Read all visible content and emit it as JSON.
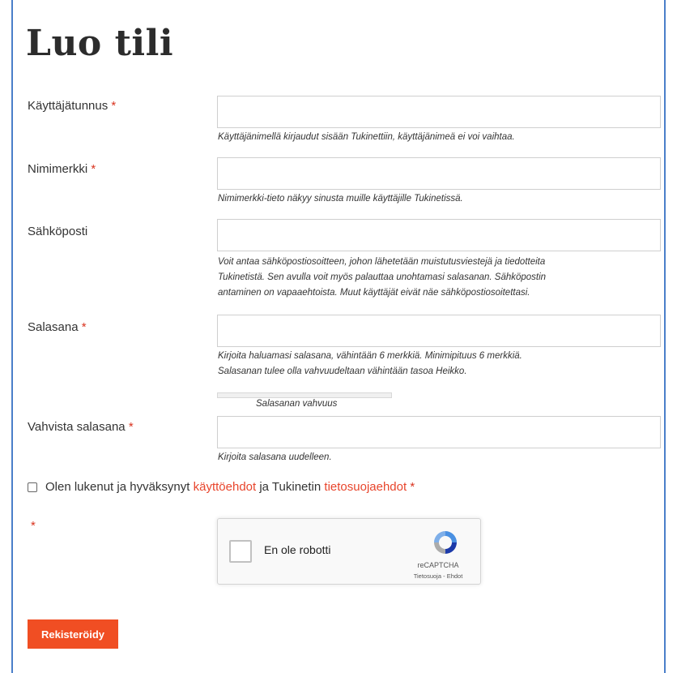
{
  "page": {
    "title": "Luo tili"
  },
  "fields": {
    "username": {
      "label": "Käyttäjätunnus",
      "required_mark": "*",
      "value": "",
      "help": "Käyttäjänimellä kirjaudut sisään Tukinettiin, käyttäjänimeä ei voi vaihtaa."
    },
    "nickname": {
      "label": "Nimimerkki",
      "required_mark": "*",
      "value": "",
      "help": "Nimimerkki-tieto näkyy sinusta muille käyttäjille Tukinetissä."
    },
    "email": {
      "label": "Sähköposti",
      "value": "",
      "help_lines": [
        "Voit antaa sähköpostiosoitteen, johon lähetetään muistutusviestejä ja tiedotteita",
        "Tukinetistä. Sen avulla voit myös palauttaa unohtamasi salasanan. Sähköpostin",
        "antaminen on vapaaehtoista. Muut käyttäjät eivät näe sähköpostiosoitettasi."
      ]
    },
    "password": {
      "label": "Salasana",
      "required_mark": "*",
      "value": "",
      "help_lines": [
        "Kirjoita haluamasi salasana, vähintään 6 merkkiä. Minimipituus 6 merkkiä.",
        "Salasanan tulee olla vahvuudeltaan vähintään tasoa Heikko."
      ],
      "strength_label": "Salasanan vahvuus",
      "strength_level": 0
    },
    "password_confirm": {
      "label": "Vahvista salasana",
      "required_mark": "*",
      "value": "",
      "help": "Kirjoita salasana uudelleen."
    }
  },
  "terms": {
    "checked": false,
    "text_before": "Olen lukenut ja hyväksynyt",
    "link_terms": "käyttöehdot",
    "text_middle": "ja Tukinetin",
    "link_privacy": "tietosuojaehdot",
    "required_mark": "*"
  },
  "captcha": {
    "required_mark": "*",
    "checkbox_label": "En ole robotti",
    "brand": "reCAPTCHA",
    "privacy_link": "Tietosuoja",
    "separator": " - ",
    "terms_link": "Ehdot",
    "icon": "recaptcha-logo-icon"
  },
  "submit": {
    "label": "Rekisteröidy"
  },
  "colors": {
    "accent": "#f04e23",
    "required": "#d9331f",
    "link": "#e8452c",
    "frame": "#4a7fc9"
  }
}
